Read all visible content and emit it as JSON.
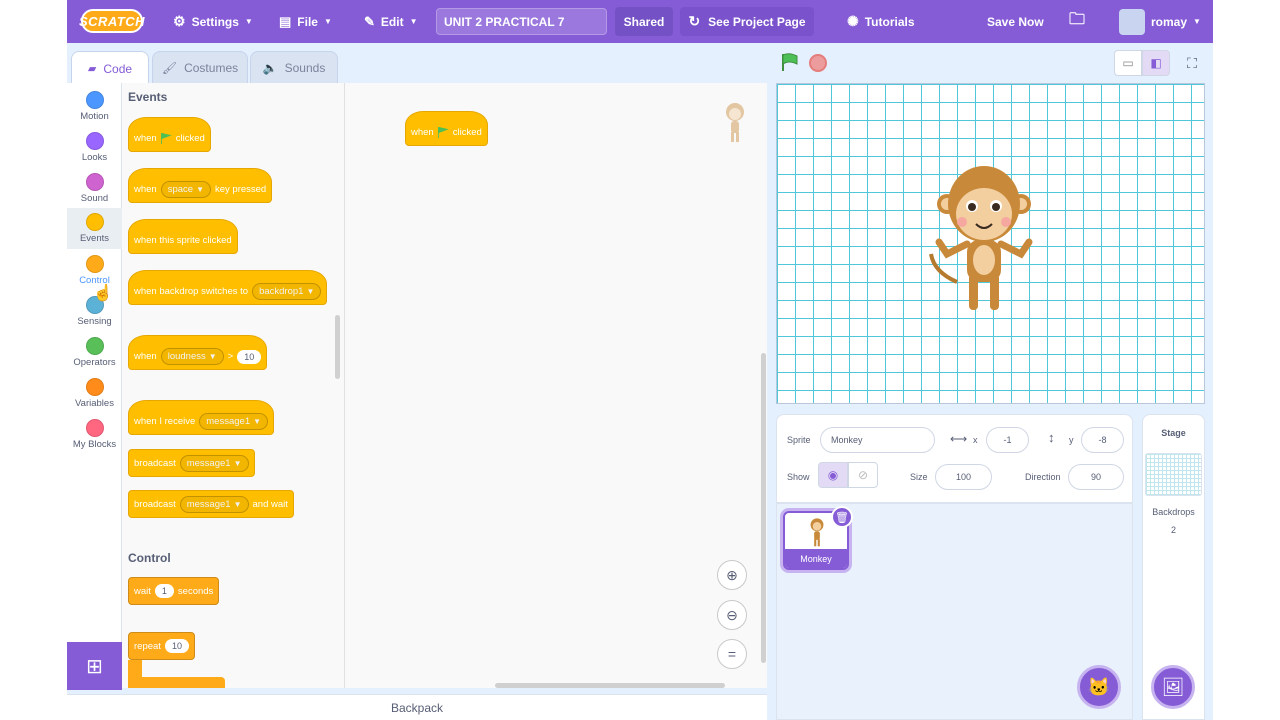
{
  "menubar": {
    "logo": "SCRATCH",
    "settings": "Settings",
    "file": "File",
    "edit": "Edit",
    "project_title": "UNIT 2 PRACTICAL 7",
    "shared": "Shared",
    "see_project_page": "See Project Page",
    "tutorials": "Tutorials",
    "save_now": "Save Now",
    "username": "romay"
  },
  "tabs": {
    "code": "Code",
    "costumes": "Costumes",
    "sounds": "Sounds"
  },
  "categories": [
    {
      "label": "Motion",
      "color": "#4c97ff"
    },
    {
      "label": "Looks",
      "color": "#9966ff"
    },
    {
      "label": "Sound",
      "color": "#cf63cf"
    },
    {
      "label": "Events",
      "color": "#ffbf00"
    },
    {
      "label": "Control",
      "color": "#ffab19"
    },
    {
      "label": "Sensing",
      "color": "#5cb1d6"
    },
    {
      "label": "Operators",
      "color": "#59c059"
    },
    {
      "label": "Variables",
      "color": "#ff8c1a"
    },
    {
      "label": "My Blocks",
      "color": "#ff6680"
    }
  ],
  "palette": {
    "events_header": "Events",
    "control_header": "Control",
    "b_when": "when",
    "b_clicked": "clicked",
    "b_space": "space",
    "b_key_pressed": "key pressed",
    "b_sprite_clicked": "when this sprite clicked",
    "b_backdrop_switches": "when backdrop switches to",
    "b_backdrop1": "backdrop1",
    "b_loudness": "loudness",
    "b_gt": ">",
    "b_ten": "10",
    "b_when_receive": "when I receive",
    "b_message1": "message1",
    "b_broadcast": "broadcast",
    "b_and_wait": "and wait",
    "b_wait": "wait",
    "b_one": "1",
    "b_seconds": "seconds",
    "b_repeat": "repeat"
  },
  "script": {
    "when": "when",
    "clicked": "clicked"
  },
  "backpack": "Backpack",
  "sprite_info": {
    "sprite_label": "Sprite",
    "sprite_name": "Monkey",
    "x_label": "x",
    "x_value": "-1",
    "y_label": "y",
    "y_value": "-8",
    "show_label": "Show",
    "size_label": "Size",
    "size_value": "100",
    "direction_label": "Direction",
    "direction_value": "90"
  },
  "sprites": [
    {
      "name": "Monkey"
    }
  ],
  "stage_panel": {
    "title": "Stage",
    "backdrops_label": "Backdrops",
    "backdrops_count": "2"
  },
  "colors": {
    "accent": "#855cd6",
    "events": "#ffbf00",
    "grid": "#4fc7d9"
  }
}
